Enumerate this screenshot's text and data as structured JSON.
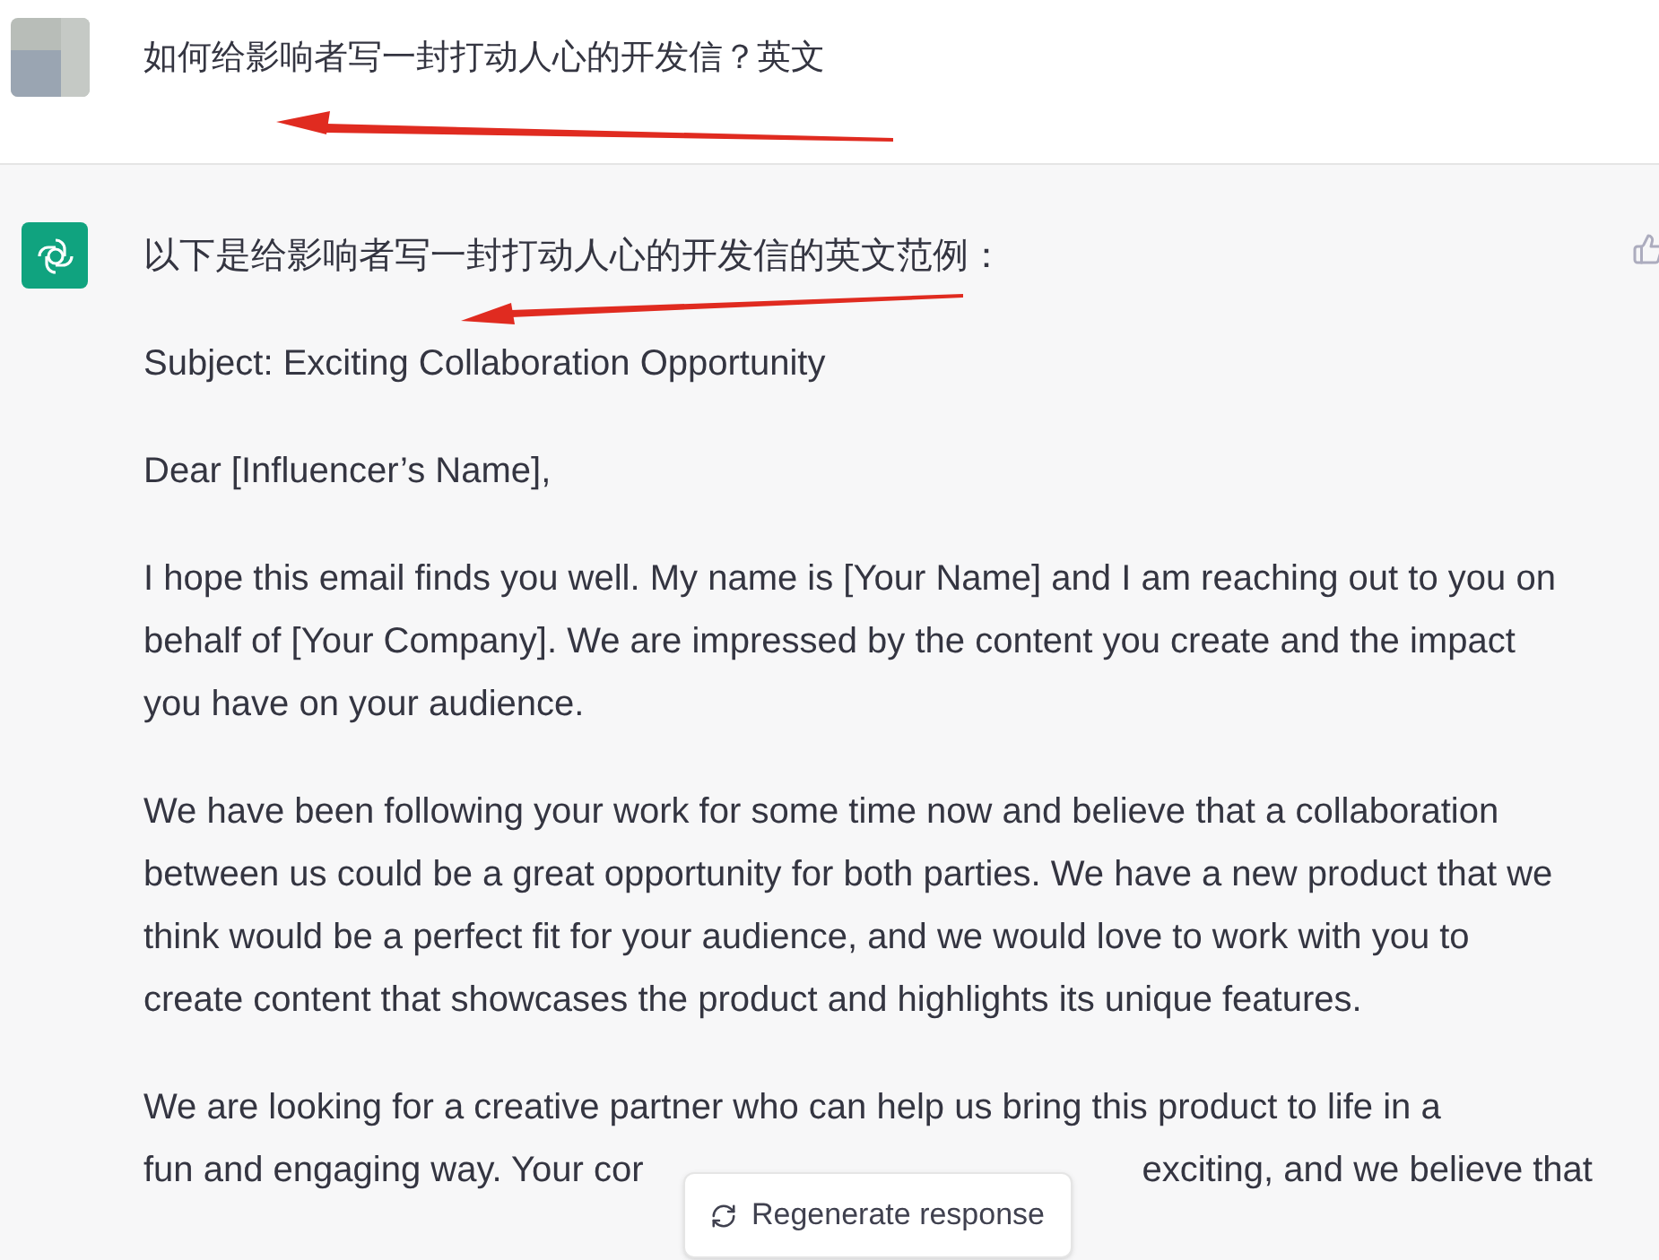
{
  "question": {
    "text": "如何给影响者写一封打动人心的开发信？英文"
  },
  "answer": {
    "intro": "以下是给影响者写一封打动人心的开发信的英文范例：",
    "paragraphs": [
      "Subject: Exciting Collaboration Opportunity",
      "Dear [Influencer’s Name],",
      "I hope this email finds you well. My name is [Your Name] and I am reaching out to you on behalf of [Your Company]. We are impressed by the content you create and the impact you have on your audience.",
      "We have been following your work for some time now and believe that a collaboration between us could be a great opportunity for both parties. We have a new product that we think would be a perfect fit for your audience, and we would love to work with you to create content that showcases the product and highlights its unique features."
    ],
    "partial_paragraph": {
      "line_1": "We are looking for a creative partner who can help us bring this product to life in a",
      "line_2_start": "fun and engaging way. Your cor",
      "line_2_end": "exciting, and we believe that"
    }
  },
  "regenerate_button": {
    "label": "Regenerate response"
  }
}
